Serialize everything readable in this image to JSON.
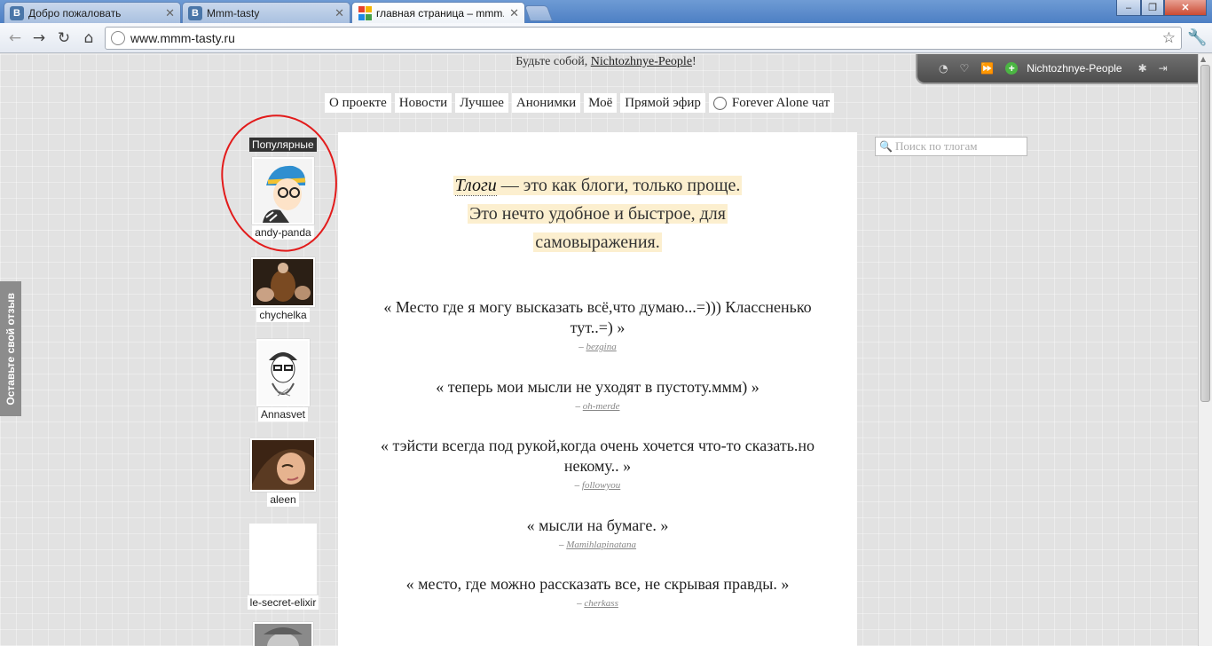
{
  "browser": {
    "tabs": [
      {
        "label": "Добро пожаловать",
        "favicon": "В"
      },
      {
        "label": "Mmm-tasty",
        "favicon": "В"
      },
      {
        "label": "главная страница – mmm...",
        "favicon": "grid"
      }
    ],
    "address": "www.mmm-tasty.ru",
    "window_controls": {
      "minimize": "–",
      "maximize": "❐",
      "close": "✕"
    }
  },
  "page": {
    "motto_prefix": "Будьте собой, ",
    "motto_user": "Nichtozhnye-People",
    "motto_suffix": "!",
    "usertool": {
      "username": "Nichtozhnye-People"
    },
    "nav": [
      "О проекте",
      "Новости",
      "Лучшее",
      "Анонимки",
      "Моё",
      "Прямой эфир",
      "Forever Alone чат"
    ],
    "popular_label": "Популярные",
    "popular_users": [
      {
        "name": "andy-panda"
      },
      {
        "name": "chychelka"
      },
      {
        "name": "Annasvet"
      },
      {
        "name": "aleen"
      },
      {
        "name": "le-secret-elixir"
      }
    ],
    "feedback_label": "Оставьте свой отзыв",
    "intro": {
      "term": "Тлоги",
      "line1_rest": " — это как блоги, только проще.",
      "line2": "Это нечто удобное и быстрое, для",
      "line3": "самовыражения."
    },
    "quotes": [
      {
        "text": "« Место где я могу высказать всё,что думаю...=))) Классненько тут..=) »",
        "author": "bezgina"
      },
      {
        "text": "« теперь мои мысли не уходят в пустоту.ммм) »",
        "author": "oh-merde"
      },
      {
        "text": "« тэйсти всегда под рукой,когда очень хочется что-то сказать.но некому.. »",
        "author": "followyou"
      },
      {
        "text": "« мысли на бумаге. »",
        "author": "Mamihlapinatana"
      },
      {
        "text": "« место, где можно рассказать все, не скрывая правды. »",
        "author": "cherkass"
      }
    ],
    "search_placeholder": "Поиск по тлогам",
    "colors": {
      "highlight": "#fcefcf",
      "accent_red": "#e21b1b"
    }
  }
}
